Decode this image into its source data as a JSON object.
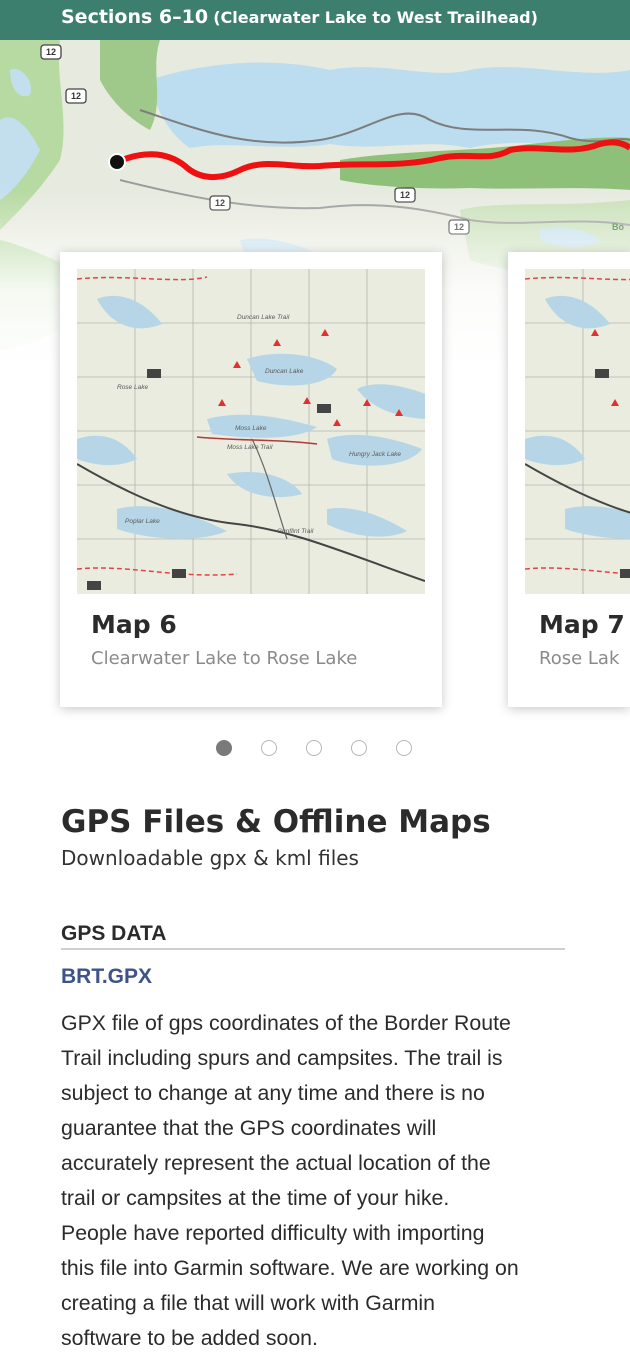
{
  "header": {
    "title": "Sections 6–10",
    "subtitle": "(Clearwater Lake to West Trailhead)"
  },
  "overview_map": {
    "road_markers": [
      "12",
      "12",
      "12",
      "12",
      "12"
    ],
    "corner_label": "Bo"
  },
  "maps": [
    {
      "title": "Map 6",
      "subtitle": "Clearwater Lake to Rose Lake",
      "thumb_labels": [
        "Duncan Lake",
        "Moss Lake",
        "Hungry Jack Lake",
        "Poplar Lake",
        "Rose Lake",
        "Duncan Lake Trail",
        "Moss Lake Trail",
        "Gunflint Trail"
      ]
    },
    {
      "title": "Map 7",
      "subtitle": "Rose Lak"
    }
  ],
  "pagination": {
    "count": 5,
    "active_index": 0
  },
  "gps": {
    "heading": "GPS Files & Offline Maps",
    "subheading": "Downloadable gpx & kml files",
    "section_label": "GPS DATA",
    "file_link": "BRT.GPX",
    "description_lines": [
      "GPX file of gps coordinates of the Border Route",
      "Trail including spurs and campsites. The trail is",
      "subject to change at any time and there is no",
      "guarantee that the GPS coordinates will",
      "accurately represent the actual location of the",
      "trail or campsites at the time of your hike.",
      "People have reported difficulty with importing",
      "this file into Garmin software. We are working on",
      "creating a file that will work with Garmin",
      "software to be added soon."
    ]
  },
  "colors": {
    "banner": "#3d7f6e",
    "trail": "#ee1111",
    "link": "#3f5389",
    "forest": "#9fc98a",
    "water": "#bcdcef"
  }
}
